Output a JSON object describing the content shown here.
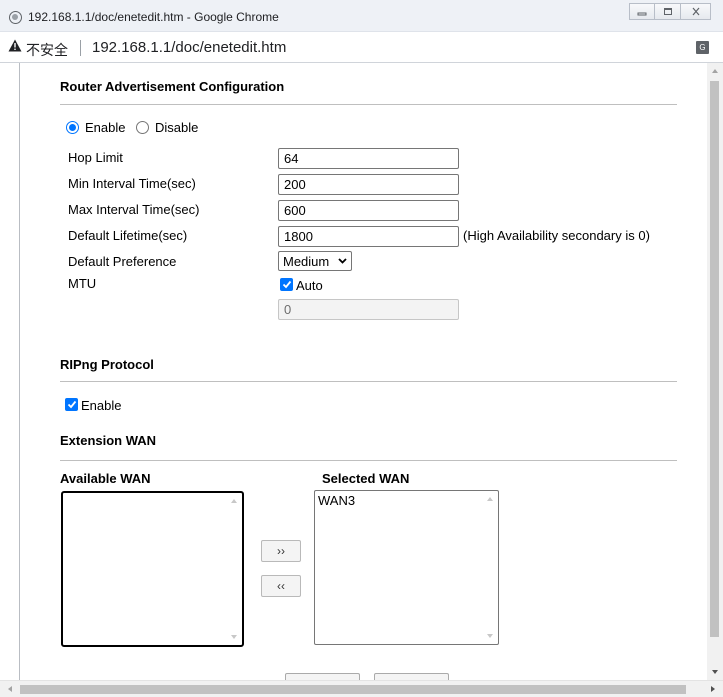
{
  "window": {
    "title": "192.168.1.1/doc/enetedit.htm - Google Chrome",
    "security_label": "不安全",
    "url": "192.168.1.1/doc/enetedit.htm"
  },
  "ra": {
    "title": "Router Advertisement Configuration",
    "enable_label": "Enable",
    "disable_label": "Disable",
    "selected": "Enable",
    "fields": {
      "hop_limit": {
        "label": "Hop Limit",
        "value": "64"
      },
      "min_interval": {
        "label": "Min Interval Time(sec)",
        "value": "200"
      },
      "max_interval": {
        "label": "Max Interval Time(sec)",
        "value": "600"
      },
      "default_lifetime": {
        "label": "Default Lifetime(sec)",
        "value": "1800",
        "note": "(High Availability secondary is 0)"
      },
      "default_preference": {
        "label": "Default Preference",
        "value": "Medium"
      },
      "mtu": {
        "label": "MTU",
        "auto_label": "Auto",
        "auto_checked": true,
        "value": "0"
      }
    }
  },
  "ripng": {
    "title": "RIPng Protocol",
    "enable_label": "Enable",
    "enable_checked": true
  },
  "extension_wan": {
    "title": "Extension WAN",
    "available_label": "Available WAN",
    "available_items": [],
    "selected_label": "Selected WAN",
    "selected_items": [
      "WAN3"
    ],
    "add_button": "››",
    "remove_button": "‹‹"
  },
  "colors": {
    "accent": "#0075ff",
    "titlebar": "#eef1f6",
    "divider": "#bfbfbf"
  }
}
